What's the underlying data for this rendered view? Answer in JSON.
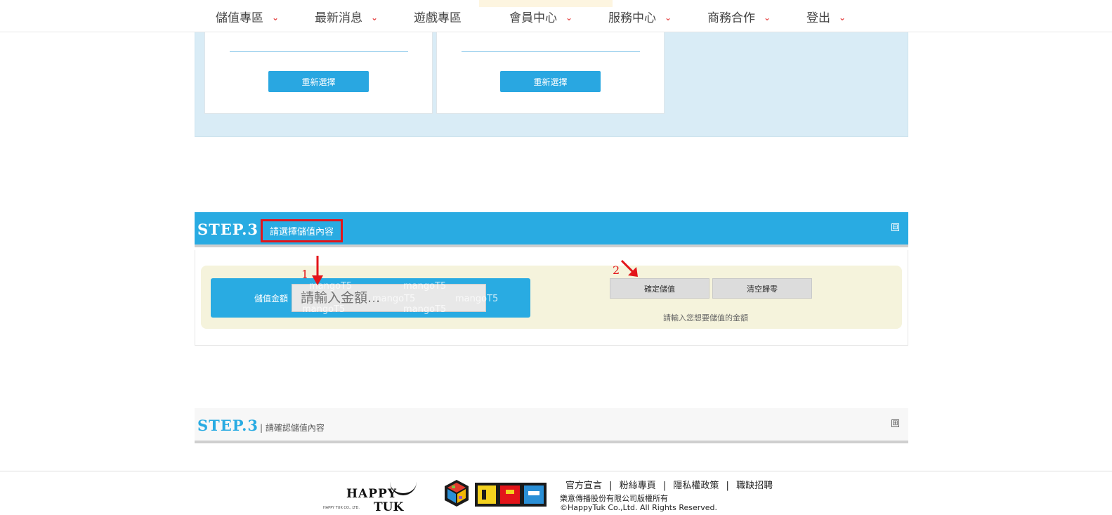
{
  "nav": {
    "items": [
      {
        "label": "儲值專區",
        "has_dropdown": true
      },
      {
        "label": "最新消息",
        "has_dropdown": true
      },
      {
        "label": "遊戲專區",
        "has_dropdown": false
      },
      {
        "label": "會員中心",
        "has_dropdown": true
      },
      {
        "label": "服務中心",
        "has_dropdown": true
      },
      {
        "label": "商務合作",
        "has_dropdown": true
      },
      {
        "label": "登出",
        "has_dropdown": true
      }
    ],
    "chevron": "⌄"
  },
  "step2": {
    "reselect_label": "重新選擇"
  },
  "step3": {
    "step_label": "STEP.3",
    "subtitle": "請選擇儲值內容",
    "collapse_symbol": "⊟",
    "amount_label": "儲值金額",
    "amount_placeholder": "請輸入金額...",
    "amount_value": "",
    "watermark_text": "mangoT5",
    "confirm_label": "確定儲值",
    "clear_label": "清空歸零",
    "hint": "請輸入您想要儲值的金額",
    "annotation_1": "1",
    "annotation_2": "2"
  },
  "step3_confirm": {
    "step_label": "STEP.3",
    "subtitle": "| 請確認儲值內容",
    "expand_symbol": "⊞"
  },
  "footer": {
    "links": [
      "官方宣言",
      "粉絲專頁",
      "隱私權政策",
      "職缺招聘"
    ],
    "separator": "|",
    "company": "樂意傳播股份有限公司版權所有",
    "copyright": "©HappyTuk Co.,Ltd. All Rights Reserved.",
    "logo_happy_top": "HAPPY",
    "logo_happy_bottom": "TUK",
    "logo_happy_small": "HAPPY TUK CO., LTD."
  },
  "colors": {
    "primary_blue": "#29abe2",
    "highlight_red": "#e3151a",
    "panel_cream": "#f5f3dc",
    "step2_bg": "#d9ecf6"
  }
}
